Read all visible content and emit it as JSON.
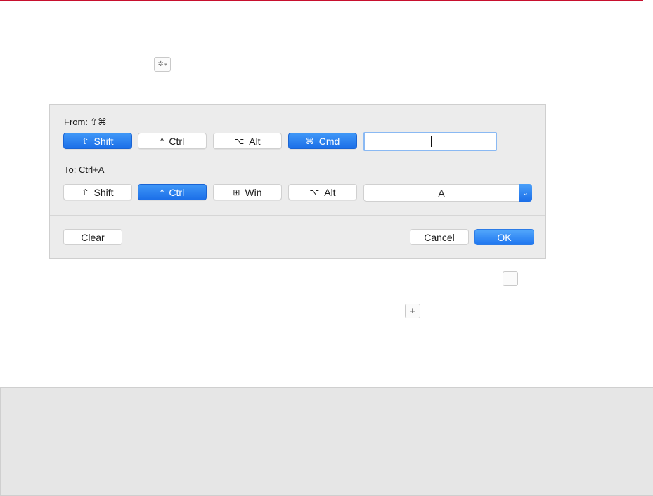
{
  "toolbar": {
    "gear_icon": "gear-icon",
    "gear_caret": "▾"
  },
  "dialog": {
    "from_label": "From:",
    "from_symbols": "⇧⌘",
    "to_label": "To: Ctrl+A",
    "from_keys": [
      {
        "symbol": "⇧",
        "label": "Shift",
        "active": true
      },
      {
        "symbol": "^",
        "label": "Ctrl",
        "active": false
      },
      {
        "symbol": "⌥",
        "label": "Alt",
        "active": false
      },
      {
        "symbol": "⌘",
        "label": "Cmd",
        "active": true
      }
    ],
    "from_input_value": "",
    "to_keys": [
      {
        "symbol": "⇧",
        "label": "Shift",
        "active": false
      },
      {
        "symbol": "^",
        "label": "Ctrl",
        "active": true
      },
      {
        "symbol": "⊞",
        "label": "Win",
        "active": false
      },
      {
        "symbol": "⌥",
        "label": "Alt",
        "active": false
      }
    ],
    "to_select_value": "A",
    "to_select_arrow": "⌄",
    "clear_label": "Clear",
    "cancel_label": "Cancel",
    "ok_label": "OK"
  },
  "list_controls": {
    "minus_label": "–",
    "plus_label": "+"
  },
  "colors": {
    "accent_blue": "#1c6fe8",
    "top_rule": "#c8102e",
    "dialog_bg": "#ececec",
    "bottom_panel": "#e6e6e6"
  }
}
